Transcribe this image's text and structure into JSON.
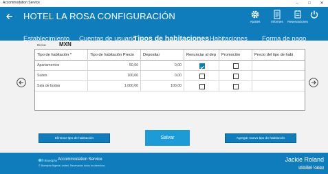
{
  "window": {
    "title": "Accommodation Service",
    "minimize": "–",
    "maximize": "□",
    "close": "✕"
  },
  "header": {
    "title": "HOTEL LA ROSA CONFIGURACIÓN",
    "actions": [
      {
        "label": "Ajustes",
        "icon": "gear-icon"
      },
      {
        "label": "Informes",
        "icon": "document-icon"
      },
      {
        "label": "Reservaciones",
        "icon": "reservations-icon"
      },
      {
        "label": "",
        "icon": "power-icon"
      }
    ]
  },
  "tabs": [
    {
      "label": "Establecimiento",
      "active": false
    },
    {
      "label": "Cuentas de usuario",
      "active": false
    },
    {
      "label": "Tipos de habitaciones",
      "active": true
    },
    {
      "label": "Habitaciones",
      "active": false
    },
    {
      "label": "Forma de pago",
      "active": false
    }
  ],
  "currency": {
    "label": "Divisa:",
    "value": "MXN"
  },
  "table": {
    "columns": [
      "Tipo de habitación *",
      "Tipo de habitación Precio",
      "Depositar",
      "Renunciar al dep",
      "Promoción",
      "Precio del tipo de habi"
    ],
    "rows": [
      {
        "name": "Apartamentos",
        "price": "50,00",
        "deposit": "0,00",
        "waive": true,
        "promo": false,
        "type_price": ""
      },
      {
        "name": "Suites",
        "price": "100,00",
        "deposit": "0,00",
        "waive": false,
        "promo": false,
        "type_price": ""
      },
      {
        "name": "Sala de bodas",
        "price": "1.000,00",
        "deposit": "100,00",
        "waive": false,
        "promo": false,
        "type_price": ""
      }
    ]
  },
  "buttons": {
    "delete": "Eliminar tipo de habitación",
    "save": "Salvar",
    "add": "Agregar nuevo tipo de habitación"
  },
  "footer": {
    "logo_text": "Bluedpha",
    "service": "Accommodation Service",
    "copyright": "© Bluedpha Nigeria Limited. Reservados todos los derechos.",
    "user": "Jackie Roland",
    "privacy": "Intimidad",
    "separator": "|",
    "help": "Apoyo"
  },
  "colors": {
    "accent": "#0f7dbb",
    "save_button": "#1c9bd6",
    "content_bg": "#f2f2f2"
  }
}
